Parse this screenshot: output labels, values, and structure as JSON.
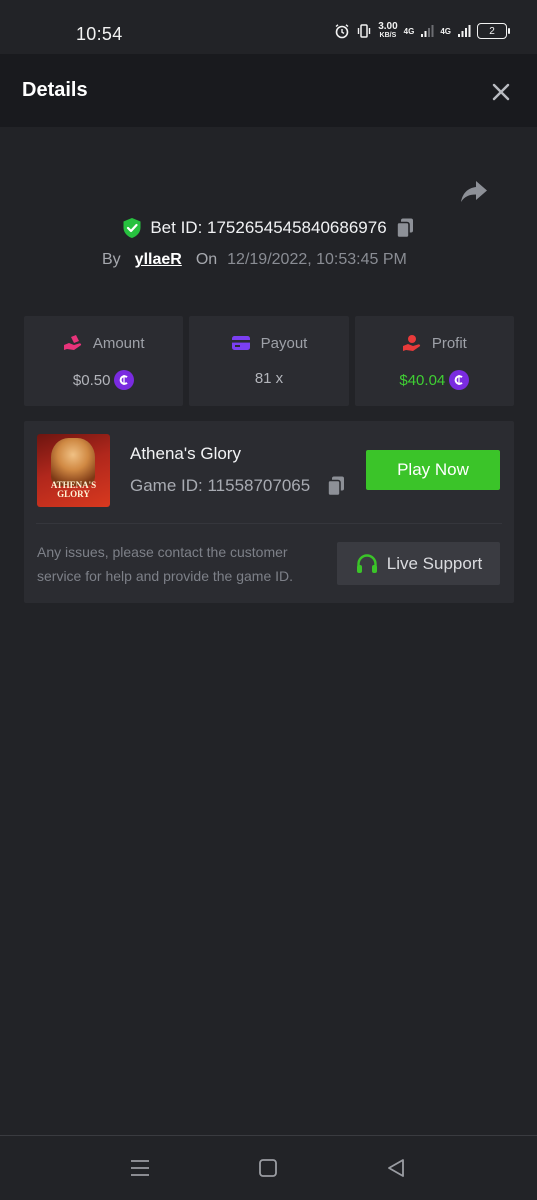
{
  "status_bar": {
    "time": "10:54",
    "speed_value": "3.00",
    "speed_unit": "KB/S",
    "network_1": "4G",
    "network_2": "4G",
    "battery_level": "2"
  },
  "header": {
    "title": "Details"
  },
  "bet": {
    "bet_id_text": "Bet ID: 1752654545840686976",
    "by_label": "By",
    "username": "yllaeR",
    "on_label": "On",
    "date": "12/19/2022, 10:53:45 PM"
  },
  "stats": {
    "amount": {
      "label": "Amount",
      "value": "$0.50"
    },
    "payout": {
      "label": "Payout",
      "value": "81 x"
    },
    "profit": {
      "label": "Profit",
      "value": "$40.04"
    }
  },
  "game": {
    "name": "Athena's Glory",
    "game_id_text": "Game ID: 11558707065",
    "thumbnail_text": "ATHENA'S GLORY",
    "play_label": "Play Now",
    "notice": "Any issues, please contact the customer service for help and provide the game ID.",
    "support_label": "Live Support"
  },
  "colors": {
    "accent_green": "#3bc429",
    "profit_green": "#3fcf33",
    "coin_purple": "#7a2be0",
    "shield_green": "#27c13f",
    "amount_pink": "#e8337a",
    "payout_purple": "#7b3ff2",
    "profit_red": "#e83a3a"
  },
  "icons": {
    "close": "close-icon",
    "share": "share-icon",
    "shield": "shield-check-icon",
    "copy": "copy-icon",
    "amount": "hand-coins-icon",
    "payout": "credit-card-icon",
    "profit": "hand-money-icon",
    "coin": "coin-icon",
    "support": "headset-icon"
  }
}
